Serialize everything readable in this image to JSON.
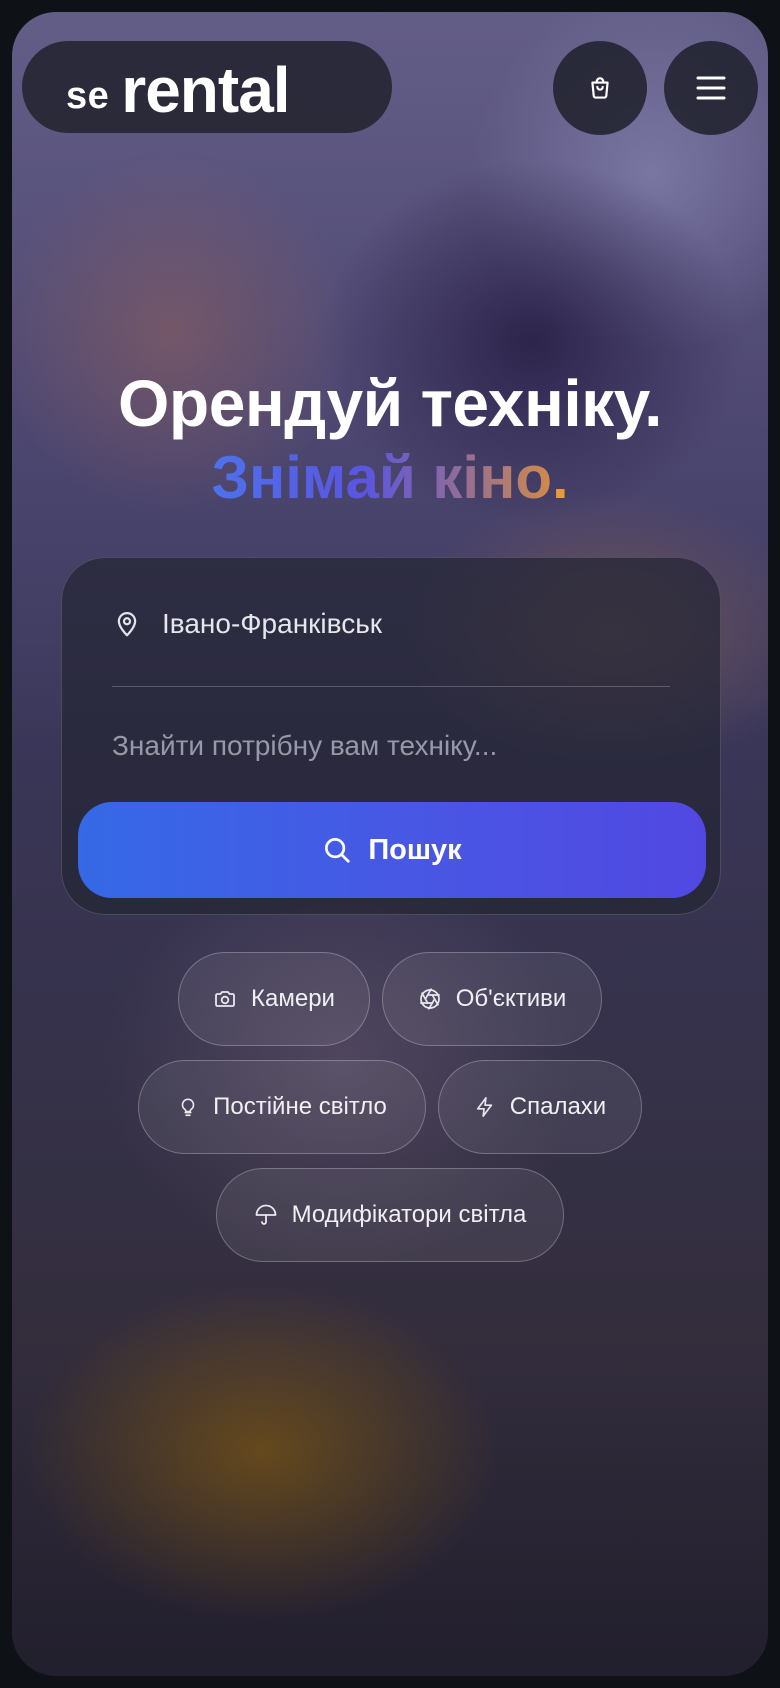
{
  "header": {
    "logo_prefix": "se",
    "logo_main": "rental",
    "cart_icon": "shopping-bag-icon",
    "menu_icon": "hamburger-menu-icon"
  },
  "hero": {
    "line1": "Орендуй техніку.",
    "line2": "Знімай кіно",
    "line2_dot": "."
  },
  "search": {
    "location": "Івано-Франківськ",
    "location_icon": "map-pin-icon",
    "query_value": "",
    "query_placeholder": "Знайти потрібну вам техніку...",
    "button_label": "Пошук",
    "button_icon": "search-icon"
  },
  "categories": [
    {
      "label": "Камери",
      "icon": "camera-icon"
    },
    {
      "label": "Об'єктиви",
      "icon": "aperture-icon"
    },
    {
      "label": "Постійне світло",
      "icon": "lightbulb-icon"
    },
    {
      "label": "Спалахи",
      "icon": "lightning-icon"
    },
    {
      "label": "Модифікатори світла",
      "icon": "umbrella-icon"
    }
  ],
  "colors": {
    "accent_blue": "#3f5ce5",
    "gradient_start": "#4d72ec",
    "gradient_end": "#d08a4a",
    "dot_orange": "#e59a3c"
  }
}
